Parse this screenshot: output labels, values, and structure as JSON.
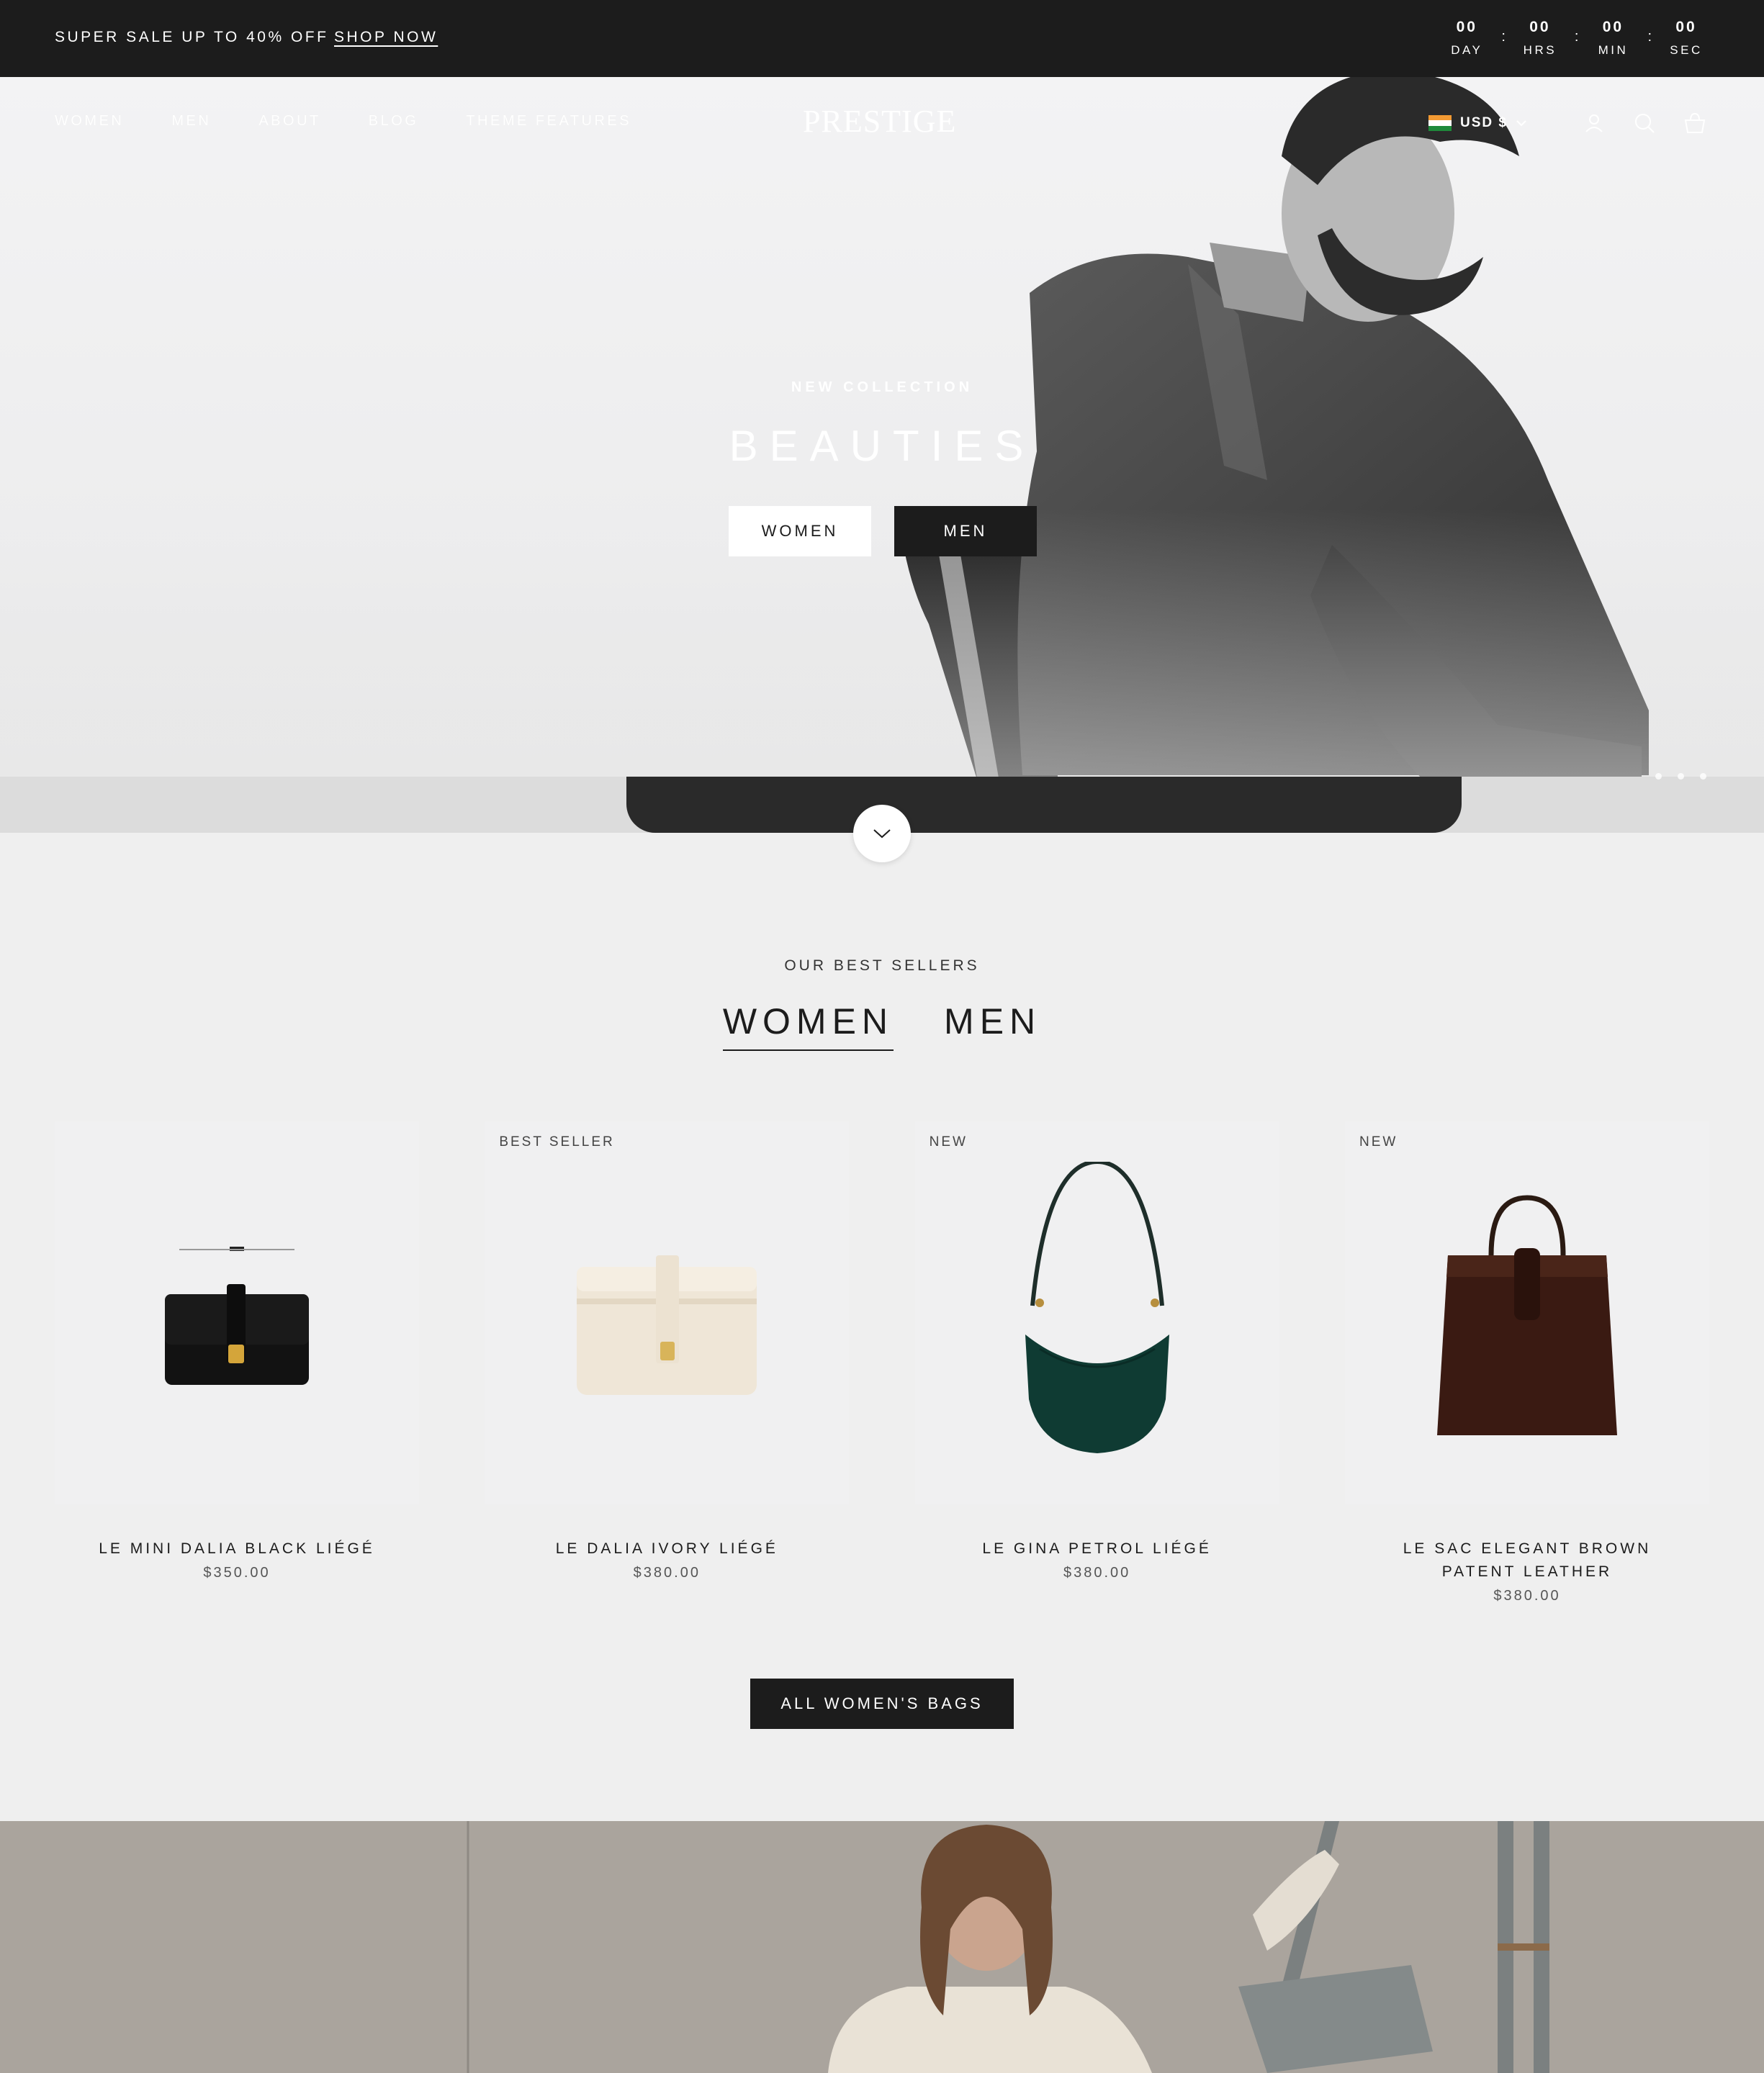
{
  "announcement": {
    "message": "SUPER SALE UP TO 40% OFF",
    "link": "SHOP NOW",
    "countdown": [
      {
        "value": "00",
        "label": "DAY"
      },
      {
        "value": "00",
        "label": "HRS"
      },
      {
        "value": "00",
        "label": "MIN"
      },
      {
        "value": "00",
        "label": "SEC"
      }
    ],
    "separator": ":"
  },
  "nav": {
    "links": [
      "WOMEN",
      "MEN",
      "ABOUT",
      "BLOG",
      "THEME FEATURES"
    ],
    "logo": "PRESTIGE",
    "currency": "USD $",
    "icons": [
      "account-icon",
      "search-icon",
      "cart-icon"
    ]
  },
  "hero": {
    "kicker": "NEW COLLECTION",
    "title": "BEAUTIES",
    "buttons": {
      "women": "WOMEN",
      "men": "MEN"
    }
  },
  "best_sellers": {
    "eyebrow": "OUR BEST SELLERS",
    "tabs": {
      "women": "WOMEN",
      "men": "MEN"
    },
    "active_tab": "WOMEN",
    "products": [
      {
        "badge": "",
        "title": "LE MINI DALIA BLACK LIÉGÉ",
        "price": "$350.00"
      },
      {
        "badge": "BEST SELLER",
        "title": "LE DALIA IVORY LIÉGÉ",
        "price": "$380.00"
      },
      {
        "badge": "NEW",
        "title": "LE GINA PETROL LIÉGÉ",
        "price": "$380.00"
      },
      {
        "badge": "NEW",
        "title": "LE SAC ELEGANT BROWN PATENT LEATHER",
        "price": "$380.00"
      }
    ],
    "cta": "ALL WOMEN'S BAGS"
  },
  "colors": {
    "dark": "#1c1c1c",
    "background": "#efefef",
    "flag": [
      "#f39a33",
      "#ffffff",
      "#1f8a3b"
    ]
  }
}
